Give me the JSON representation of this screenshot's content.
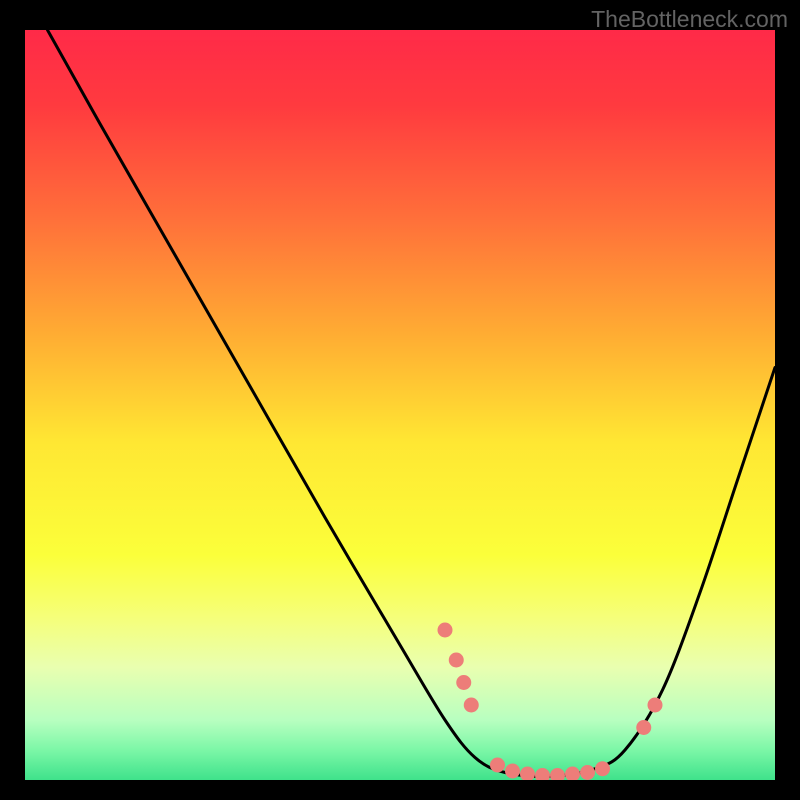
{
  "attribution": "TheBottleneck.com",
  "chart_data": {
    "type": "line",
    "title": "",
    "xlabel": "",
    "ylabel": "",
    "xlim": [
      0,
      100
    ],
    "ylim": [
      0,
      100
    ],
    "grid": false,
    "gradient_stops": [
      {
        "offset": 0.0,
        "color": "#ff2a48"
      },
      {
        "offset": 0.1,
        "color": "#ff3a3f"
      },
      {
        "offset": 0.25,
        "color": "#ff6f3a"
      },
      {
        "offset": 0.4,
        "color": "#ffaa33"
      },
      {
        "offset": 0.55,
        "color": "#ffe733"
      },
      {
        "offset": 0.7,
        "color": "#fbff3a"
      },
      {
        "offset": 0.78,
        "color": "#f6ff77"
      },
      {
        "offset": 0.85,
        "color": "#e9ffb0"
      },
      {
        "offset": 0.92,
        "color": "#b8ffc0"
      },
      {
        "offset": 0.96,
        "color": "#7cf7a7"
      },
      {
        "offset": 1.0,
        "color": "#3fe28b"
      }
    ],
    "curve": [
      {
        "x": 3.0,
        "y": 100.0
      },
      {
        "x": 10.0,
        "y": 87.5
      },
      {
        "x": 20.0,
        "y": 70.0
      },
      {
        "x": 30.0,
        "y": 52.5
      },
      {
        "x": 40.0,
        "y": 35.0
      },
      {
        "x": 50.0,
        "y": 18.0
      },
      {
        "x": 56.0,
        "y": 8.0
      },
      {
        "x": 60.0,
        "y": 3.0
      },
      {
        "x": 64.0,
        "y": 1.0
      },
      {
        "x": 70.0,
        "y": 0.5
      },
      {
        "x": 76.0,
        "y": 1.5
      },
      {
        "x": 80.0,
        "y": 4.0
      },
      {
        "x": 85.0,
        "y": 12.0
      },
      {
        "x": 90.0,
        "y": 25.0
      },
      {
        "x": 95.0,
        "y": 40.0
      },
      {
        "x": 100.0,
        "y": 55.0
      }
    ],
    "markers": [
      {
        "x": 56.0,
        "y": 20.0
      },
      {
        "x": 57.5,
        "y": 16.0
      },
      {
        "x": 58.5,
        "y": 13.0
      },
      {
        "x": 59.5,
        "y": 10.0
      },
      {
        "x": 63.0,
        "y": 2.0
      },
      {
        "x": 65.0,
        "y": 1.2
      },
      {
        "x": 67.0,
        "y": 0.8
      },
      {
        "x": 69.0,
        "y": 0.6
      },
      {
        "x": 71.0,
        "y": 0.6
      },
      {
        "x": 73.0,
        "y": 0.8
      },
      {
        "x": 75.0,
        "y": 1.0
      },
      {
        "x": 77.0,
        "y": 1.5
      },
      {
        "x": 82.5,
        "y": 7.0
      },
      {
        "x": 84.0,
        "y": 10.0
      }
    ],
    "marker_color": "#ed7d79",
    "curve_color": "#000000"
  }
}
